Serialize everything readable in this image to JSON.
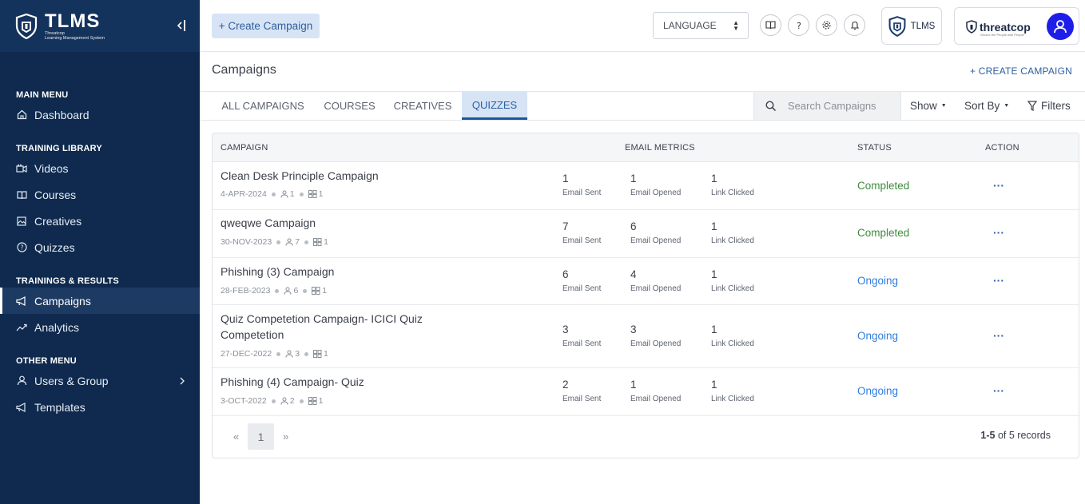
{
  "brand": {
    "title": "TLMS",
    "subtitle_line1": "Threatcop",
    "subtitle_line2": "Learning Management System"
  },
  "sidebar": {
    "sections": [
      {
        "label": "MAIN MENU",
        "items": [
          {
            "label": "Dashboard",
            "icon": "home-icon"
          }
        ]
      },
      {
        "label": "TRAINING LIBRARY",
        "items": [
          {
            "label": "Videos",
            "icon": "video-icon"
          },
          {
            "label": "Courses",
            "icon": "book-icon"
          },
          {
            "label": "Creatives",
            "icon": "image-icon"
          },
          {
            "label": "Quizzes",
            "icon": "question-icon"
          }
        ]
      },
      {
        "label": "TRAININGS & RESULTS",
        "items": [
          {
            "label": "Campaigns",
            "icon": "megaphone-icon",
            "active": true
          },
          {
            "label": "Analytics",
            "icon": "chart-icon"
          }
        ]
      },
      {
        "label": "OTHER MENU",
        "items": [
          {
            "label": "Users & Group",
            "icon": "user-icon",
            "has_submenu": true
          },
          {
            "label": "Templates",
            "icon": "megaphone-icon"
          }
        ]
      }
    ]
  },
  "topbar": {
    "create_campaign": "+ Create Campaign",
    "language": "LANGUAGE",
    "tlms_label": "TLMS",
    "threatcop_label": "threatcop",
    "threatcop_tagline": "Secure the People with People"
  },
  "page": {
    "title": "Campaigns",
    "create_link": "+ CREATE CAMPAIGN"
  },
  "tabs": [
    {
      "label": "ALL CAMPAIGNS"
    },
    {
      "label": "COURSES"
    },
    {
      "label": "CREATIVES"
    },
    {
      "label": "QUIZZES",
      "active": true
    }
  ],
  "tools": {
    "search_placeholder": "Search Campaigns",
    "show": "Show",
    "sort_by": "Sort By",
    "filters": "Filters"
  },
  "table": {
    "headers": {
      "campaign": "CAMPAIGN",
      "email_metrics": "EMAIL METRICS",
      "status": "STATUS",
      "action": "ACTION"
    },
    "metric_labels": {
      "sent": "Email Sent",
      "opened": "Email Opened",
      "clicked": "Link Clicked"
    },
    "rows": [
      {
        "name": "Clean Desk Principle Campaign",
        "date": "4-APR-2024",
        "users": "1",
        "modules": "1",
        "sent": "1",
        "opened": "1",
        "clicked": "1",
        "status": "Completed",
        "action": "···"
      },
      {
        "name": "qweqwe Campaign",
        "date": "30-NOV-2023",
        "users": "7",
        "modules": "1",
        "sent": "7",
        "opened": "6",
        "clicked": "1",
        "status": "Completed",
        "action": "···"
      },
      {
        "name": "Phishing (3) Campaign",
        "date": "28-FEB-2023",
        "users": "6",
        "modules": "1",
        "sent": "6",
        "opened": "4",
        "clicked": "1",
        "status": "Ongoing",
        "action": "···"
      },
      {
        "name": "Quiz Competetion Campaign- ICICI Quiz Competetion",
        "date": "27-DEC-2022",
        "users": "3",
        "modules": "1",
        "sent": "3",
        "opened": "3",
        "clicked": "1",
        "status": "Ongoing",
        "action": "···"
      },
      {
        "name": "Phishing (4) Campaign- Quiz",
        "date": "3-OCT-2022",
        "users": "2",
        "modules": "1",
        "sent": "2",
        "opened": "1",
        "clicked": "1",
        "status": "Ongoing",
        "action": "···"
      }
    ]
  },
  "pagination": {
    "prev": "«",
    "page": "1",
    "next": "»",
    "range": "1-5",
    "of_text": "of 5 records"
  },
  "colors": {
    "sidebar_bg": "#0f2a4e",
    "accent": "#2d5fa0",
    "completed": "#3d8b3d",
    "ongoing": "#2f7bdc",
    "avatar": "#1d1ee8"
  }
}
